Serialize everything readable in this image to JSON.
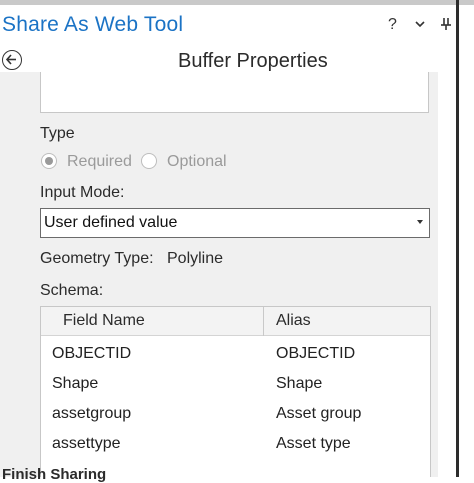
{
  "window": {
    "title": "Share As Web Tool"
  },
  "title_bar": {
    "help_glyph": "?",
    "menu_glyph": "⌄",
    "pin_glyph": "⊥"
  },
  "page": {
    "title": "Buffer Properties"
  },
  "type_section": {
    "label": "Type",
    "options": [
      {
        "label": "Required",
        "selected": true
      },
      {
        "label": "Optional",
        "selected": false
      }
    ]
  },
  "input_mode": {
    "label": "Input Mode:",
    "value": "User defined value"
  },
  "geometry": {
    "label": "Geometry Type:",
    "value": "Polyline"
  },
  "schema": {
    "label": "Schema:",
    "columns": [
      "Field Name",
      "Alias"
    ],
    "rows": [
      [
        "OBJECTID",
        "OBJECTID"
      ],
      [
        "Shape",
        "Shape"
      ],
      [
        "assetgroup",
        "Asset group"
      ],
      [
        "assettype",
        "Asset type"
      ]
    ]
  },
  "footer": {
    "partial_text": "Finish Sharing"
  },
  "icons": [
    "back-arrow-icon",
    "help-icon",
    "menu-chevron-icon",
    "pin-icon",
    "dropdown-caret-icon"
  ],
  "colors": {
    "title_blue": "#1b73c5",
    "panel_gray": "#f0f0f0"
  }
}
